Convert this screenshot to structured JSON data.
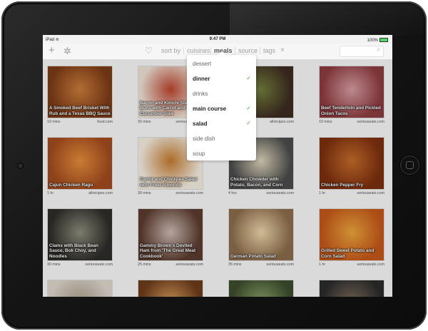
{
  "status_bar": {
    "carrier": "iPad",
    "time": "9:47 PM",
    "battery": "100%",
    "battery_level": 1.0
  },
  "toolbar": {
    "add_icon": "plus-icon",
    "settings_icon": "gear-icon",
    "favorite_icon": "heart-icon",
    "sort_by": "sort by",
    "cuisines": "cuisines",
    "meals": "meals",
    "source": "source",
    "tags": "tags",
    "clear_icon": "close-icon",
    "search_icon": "search-icon"
  },
  "meals_menu": {
    "items": [
      {
        "label": "dessert",
        "selected": false
      },
      {
        "label": "dinner",
        "selected": true
      },
      {
        "label": "drinks",
        "selected": false
      },
      {
        "label": "main course",
        "selected": true
      },
      {
        "label": "salad",
        "selected": true
      },
      {
        "label": "side dish",
        "selected": false
      },
      {
        "label": "soup",
        "selected": false
      }
    ],
    "check_glyph": "✓"
  },
  "recipes": [
    {
      "title": "A Smoked Beef Brisket With Rub and a Texas BBQ Sauce",
      "time": "10 mins",
      "source": "food.com",
      "colors": [
        "#7a3a16",
        "#c77a3a"
      ]
    },
    {
      "title": "Bacon and Kimchi Steam Buns with Carrot and Cucumber Slaw",
      "time": "30 mins",
      "source": "seriouseats.com",
      "colors": [
        "#e9ddd0",
        "#b8442e"
      ]
    },
    {
      "title": "",
      "time": "",
      "source": "allrecipes.com",
      "colors": [
        "#3c2a20",
        "#6e7a3a"
      ]
    },
    {
      "title": "Beef Tenderloin and Pickled Onion Tacos",
      "time": "10 mins",
      "source": "seriouseats.com",
      "colors": [
        "#8a3a3e",
        "#d29aa0"
      ]
    },
    {
      "title": "Cajun Chicken Ragu",
      "time": "1 hr",
      "source": "allrecipes.com",
      "colors": [
        "#a04a1e",
        "#e08a3a"
      ]
    },
    {
      "title": "Carrot and Chickpea Salad with Fried Almonds",
      "time": "30 mins",
      "source": "seriouseats.com",
      "colors": [
        "#f0e8dc",
        "#c0782e"
      ]
    },
    {
      "title": "Chicken Chowder with Potato, Bacon, and Corn",
      "time": "4 hrs",
      "source": "seriouseats.com",
      "colors": [
        "#4a4a4a",
        "#d8cfb6"
      ]
    },
    {
      "title": "Chicken Pepper Fry",
      "time": "1 hr",
      "source": "seriouseats.com",
      "colors": [
        "#7a2e0e",
        "#c06a2a"
      ]
    },
    {
      "title": "Clams with Black Bean Sauce, Bok Choy, and Noodles",
      "time": "30 mins",
      "source": "seriouseats.com",
      "colors": [
        "#2e2c28",
        "#8a8a7a"
      ]
    },
    {
      "title": "Gammy Brown's Deviled Ham from 'The Great Meat Cookbook'",
      "time": "25 mins",
      "source": "seriouseats.com",
      "colors": [
        "#5a3a2e",
        "#c9b8b0"
      ]
    },
    {
      "title": "German Potato Salad",
      "time": "35 mins",
      "source": "seriouseats.com",
      "colors": [
        "#8a6a4a",
        "#e6d2a6"
      ]
    },
    {
      "title": "Grilled Sweet Potato and Corn Salad",
      "time": "1 hr",
      "source": "seriouseats.com",
      "colors": [
        "#c0561a",
        "#e7a23a"
      ]
    },
    {
      "title": "",
      "time": "",
      "source": "",
      "colors": [
        "#d8d2c8",
        "#a89a88"
      ]
    },
    {
      "title": "",
      "time": "",
      "source": "",
      "colors": [
        "#6a3a1a",
        "#d49a5a"
      ]
    },
    {
      "title": "",
      "time": "",
      "source": "",
      "colors": [
        "#3a4a2a",
        "#8aa06a"
      ]
    },
    {
      "title": "",
      "time": "",
      "source": "",
      "colors": [
        "#2a2a2a",
        "#7a6a5a"
      ]
    }
  ]
}
